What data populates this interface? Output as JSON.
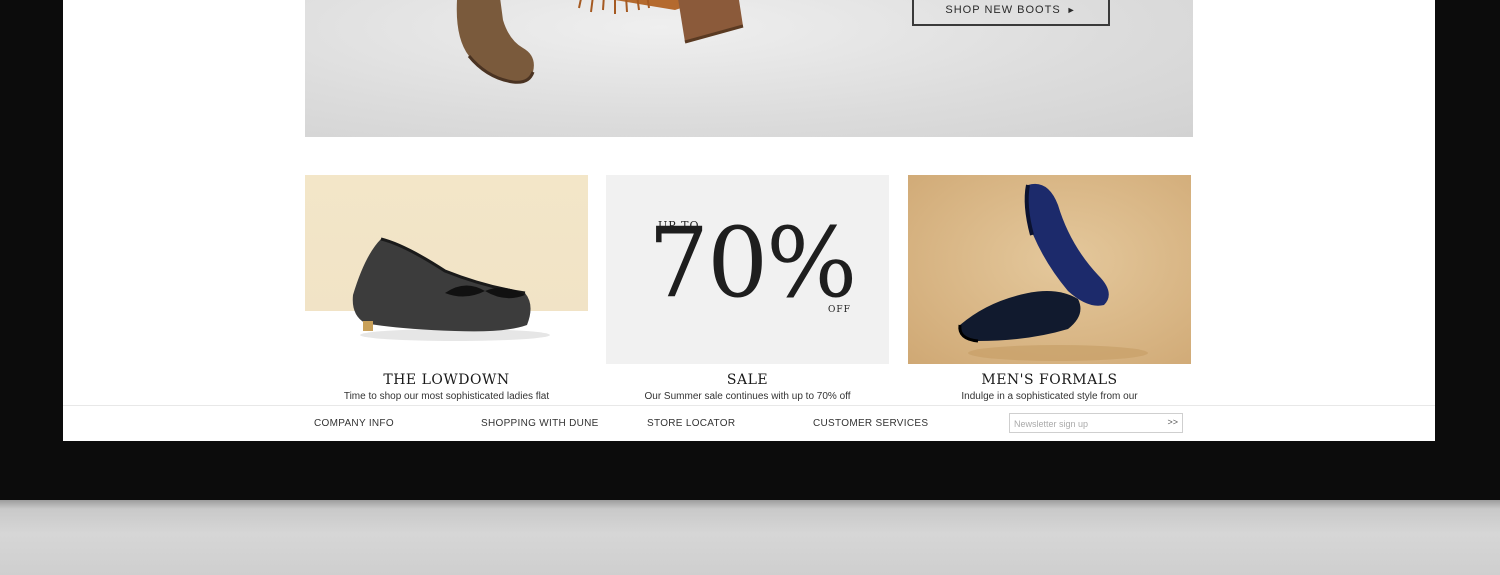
{
  "hero": {
    "cta_label": "SHOP NEW BOOTS",
    "cta_arrow": "►"
  },
  "tiles": [
    {
      "title": "THE LOWDOWN",
      "text": "Time to shop our most sophisticated ladies flat",
      "image": "black-quilted-flat-shoe-image"
    },
    {
      "title": "SALE",
      "text": "Our Summer sale continues with up to 70% off",
      "promo_upto": "UP TO",
      "promo_value": "70%",
      "promo_off": "OFF"
    },
    {
      "title": "MEN'S FORMALS",
      "text": "Indulge in a sophisticated style from our",
      "image": "mens-navy-formal-shoes-image"
    }
  ],
  "footer": {
    "links": [
      "COMPANY INFO",
      "SHOPPING WITH DUNE",
      "STORE LOCATOR",
      "CUSTOMER SERVICES"
    ],
    "newsletter_placeholder": "Newsletter sign up",
    "newsletter_button": ">>"
  }
}
